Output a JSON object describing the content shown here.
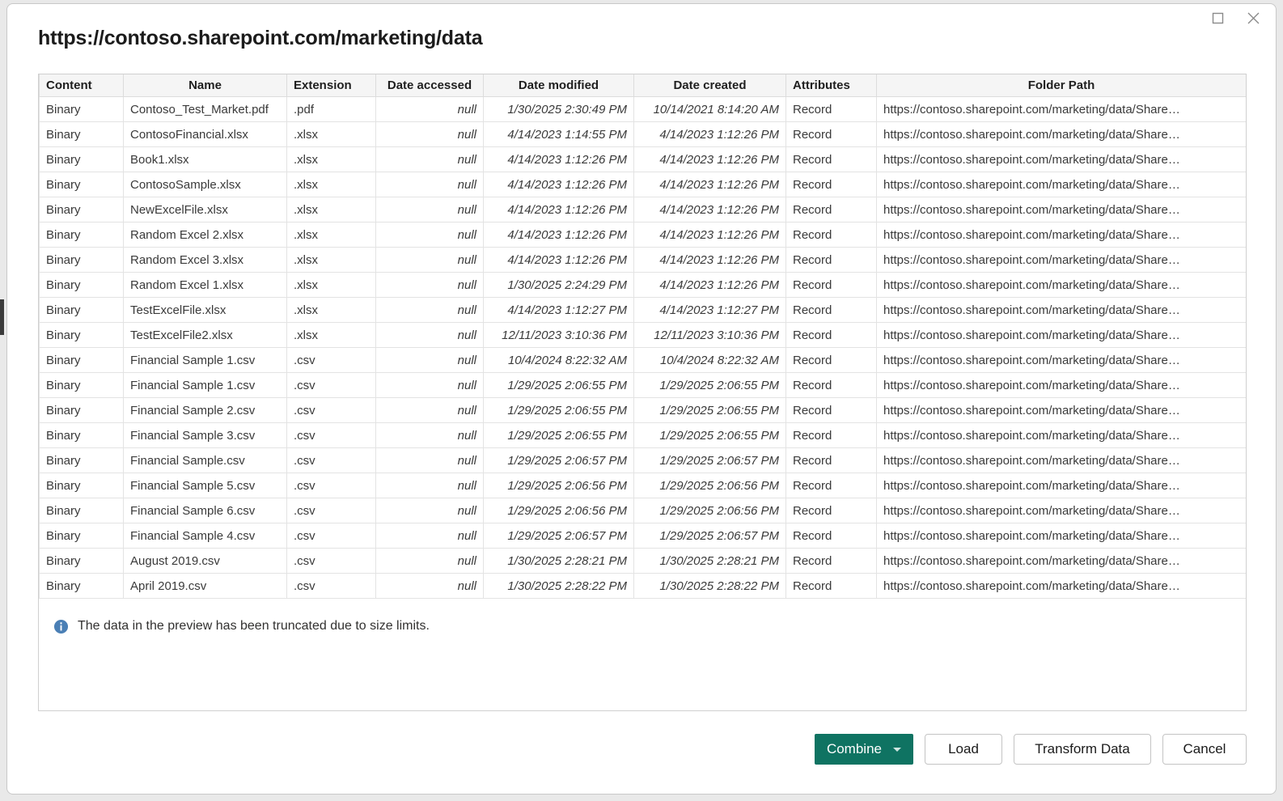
{
  "window": {
    "maximize_icon": "maximize-square-icon",
    "close_icon": "close-x-icon"
  },
  "dialog": {
    "title": "https://contoso.sharepoint.com/marketing/data"
  },
  "table": {
    "columns": [
      "Content",
      "Name",
      "Extension",
      "Date accessed",
      "Date modified",
      "Date created",
      "Attributes",
      "Folder Path"
    ],
    "rows": [
      {
        "content": "Binary",
        "name": "Contoso_Test_Market.pdf",
        "extension": ".pdf",
        "date_accessed": "null",
        "date_modified": "1/30/2025 2:30:49 PM",
        "date_created": "10/14/2021 8:14:20 AM",
        "attributes": "Record",
        "folder_path": "https://contoso.sharepoint.com/marketing/data/Share…"
      },
      {
        "content": "Binary",
        "name": "ContosoFinancial.xlsx",
        "extension": ".xlsx",
        "date_accessed": "null",
        "date_modified": "4/14/2023 1:14:55 PM",
        "date_created": "4/14/2023 1:12:26 PM",
        "attributes": "Record",
        "folder_path": "https://contoso.sharepoint.com/marketing/data/Share…"
      },
      {
        "content": "Binary",
        "name": "Book1.xlsx",
        "extension": ".xlsx",
        "date_accessed": "null",
        "date_modified": "4/14/2023 1:12:26 PM",
        "date_created": "4/14/2023 1:12:26 PM",
        "attributes": "Record",
        "folder_path": "https://contoso.sharepoint.com/marketing/data/Share…"
      },
      {
        "content": "Binary",
        "name": "ContosoSample.xlsx",
        "extension": ".xlsx",
        "date_accessed": "null",
        "date_modified": "4/14/2023 1:12:26 PM",
        "date_created": "4/14/2023 1:12:26 PM",
        "attributes": "Record",
        "folder_path": "https://contoso.sharepoint.com/marketing/data/Share…"
      },
      {
        "content": "Binary",
        "name": "NewExcelFile.xlsx",
        "extension": ".xlsx",
        "date_accessed": "null",
        "date_modified": "4/14/2023 1:12:26 PM",
        "date_created": "4/14/2023 1:12:26 PM",
        "attributes": "Record",
        "folder_path": "https://contoso.sharepoint.com/marketing/data/Share…"
      },
      {
        "content": "Binary",
        "name": "Random Excel 2.xlsx",
        "extension": ".xlsx",
        "date_accessed": "null",
        "date_modified": "4/14/2023 1:12:26 PM",
        "date_created": "4/14/2023 1:12:26 PM",
        "attributes": "Record",
        "folder_path": "https://contoso.sharepoint.com/marketing/data/Share…"
      },
      {
        "content": "Binary",
        "name": "Random Excel 3.xlsx",
        "extension": ".xlsx",
        "date_accessed": "null",
        "date_modified": "4/14/2023 1:12:26 PM",
        "date_created": "4/14/2023 1:12:26 PM",
        "attributes": "Record",
        "folder_path": "https://contoso.sharepoint.com/marketing/data/Share…"
      },
      {
        "content": "Binary",
        "name": "Random Excel 1.xlsx",
        "extension": ".xlsx",
        "date_accessed": "null",
        "date_modified": "1/30/2025 2:24:29 PM",
        "date_created": "4/14/2023 1:12:26 PM",
        "attributes": "Record",
        "folder_path": "https://contoso.sharepoint.com/marketing/data/Share…"
      },
      {
        "content": "Binary",
        "name": "TestExcelFile.xlsx",
        "extension": ".xlsx",
        "date_accessed": "null",
        "date_modified": "4/14/2023 1:12:27 PM",
        "date_created": "4/14/2023 1:12:27 PM",
        "attributes": "Record",
        "folder_path": "https://contoso.sharepoint.com/marketing/data/Share…"
      },
      {
        "content": "Binary",
        "name": "TestExcelFile2.xlsx",
        "extension": ".xlsx",
        "date_accessed": "null",
        "date_modified": "12/11/2023 3:10:36 PM",
        "date_created": "12/11/2023 3:10:36 PM",
        "attributes": "Record",
        "folder_path": "https://contoso.sharepoint.com/marketing/data/Share…"
      },
      {
        "content": "Binary",
        "name": "Financial Sample 1.csv",
        "extension": ".csv",
        "date_accessed": "null",
        "date_modified": "10/4/2024 8:22:32 AM",
        "date_created": "10/4/2024 8:22:32 AM",
        "attributes": "Record",
        "folder_path": "https://contoso.sharepoint.com/marketing/data/Share…"
      },
      {
        "content": "Binary",
        "name": "Financial Sample 1.csv",
        "extension": ".csv",
        "date_accessed": "null",
        "date_modified": "1/29/2025 2:06:55 PM",
        "date_created": "1/29/2025 2:06:55 PM",
        "attributes": "Record",
        "folder_path": "https://contoso.sharepoint.com/marketing/data/Share…"
      },
      {
        "content": "Binary",
        "name": "Financial Sample 2.csv",
        "extension": ".csv",
        "date_accessed": "null",
        "date_modified": "1/29/2025 2:06:55 PM",
        "date_created": "1/29/2025 2:06:55 PM",
        "attributes": "Record",
        "folder_path": "https://contoso.sharepoint.com/marketing/data/Share…"
      },
      {
        "content": "Binary",
        "name": "Financial Sample 3.csv",
        "extension": ".csv",
        "date_accessed": "null",
        "date_modified": "1/29/2025 2:06:55 PM",
        "date_created": "1/29/2025 2:06:55 PM",
        "attributes": "Record",
        "folder_path": "https://contoso.sharepoint.com/marketing/data/Share…"
      },
      {
        "content": "Binary",
        "name": "Financial Sample.csv",
        "extension": ".csv",
        "date_accessed": "null",
        "date_modified": "1/29/2025 2:06:57 PM",
        "date_created": "1/29/2025 2:06:57 PM",
        "attributes": "Record",
        "folder_path": "https://contoso.sharepoint.com/marketing/data/Share…"
      },
      {
        "content": "Binary",
        "name": "Financial Sample 5.csv",
        "extension": ".csv",
        "date_accessed": "null",
        "date_modified": "1/29/2025 2:06:56 PM",
        "date_created": "1/29/2025 2:06:56 PM",
        "attributes": "Record",
        "folder_path": "https://contoso.sharepoint.com/marketing/data/Share…"
      },
      {
        "content": "Binary",
        "name": "Financial Sample 6.csv",
        "extension": ".csv",
        "date_accessed": "null",
        "date_modified": "1/29/2025 2:06:56 PM",
        "date_created": "1/29/2025 2:06:56 PM",
        "attributes": "Record",
        "folder_path": "https://contoso.sharepoint.com/marketing/data/Share…"
      },
      {
        "content": "Binary",
        "name": "Financial Sample 4.csv",
        "extension": ".csv",
        "date_accessed": "null",
        "date_modified": "1/29/2025 2:06:57 PM",
        "date_created": "1/29/2025 2:06:57 PM",
        "attributes": "Record",
        "folder_path": "https://contoso.sharepoint.com/marketing/data/Share…"
      },
      {
        "content": "Binary",
        "name": "August 2019.csv",
        "extension": ".csv",
        "date_accessed": "null",
        "date_modified": "1/30/2025 2:28:21 PM",
        "date_created": "1/30/2025 2:28:21 PM",
        "attributes": "Record",
        "folder_path": "https://contoso.sharepoint.com/marketing/data/Share…"
      },
      {
        "content": "Binary",
        "name": "April 2019.csv",
        "extension": ".csv",
        "date_accessed": "null",
        "date_modified": "1/30/2025 2:28:22 PM",
        "date_created": "1/30/2025 2:28:22 PM",
        "attributes": "Record",
        "folder_path": "https://contoso.sharepoint.com/marketing/data/Share…"
      }
    ]
  },
  "notice": {
    "icon": "info-circle-icon",
    "text": "The data in the preview has been truncated due to size limits.",
    "icon_color": "#4a7fb5"
  },
  "footer": {
    "combine_label": "Combine",
    "combine_color": "#0f7362",
    "load_label": "Load",
    "transform_label": "Transform Data",
    "cancel_label": "Cancel"
  }
}
